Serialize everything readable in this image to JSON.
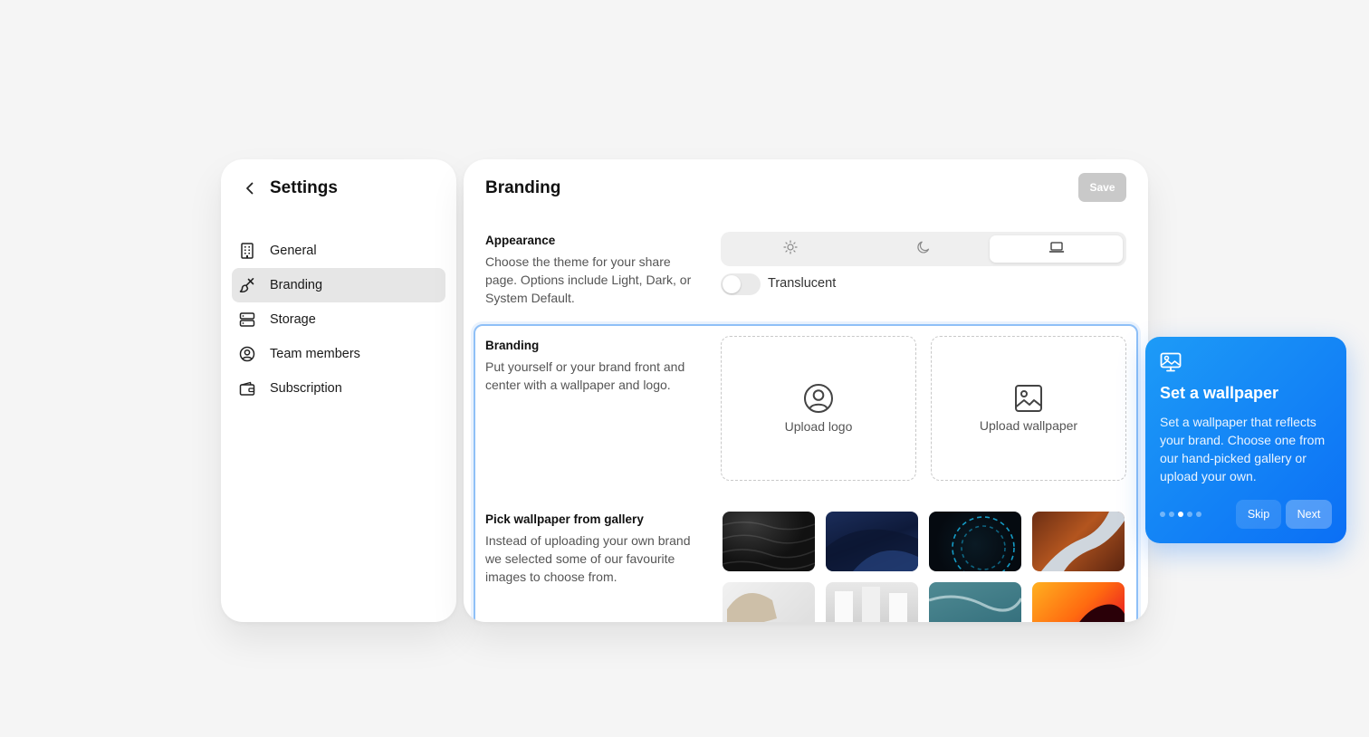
{
  "sidebar": {
    "title": "Settings",
    "items": [
      {
        "label": "General",
        "icon": "building-icon"
      },
      {
        "label": "Branding",
        "icon": "paintbrush-icon",
        "active": true
      },
      {
        "label": "Storage",
        "icon": "server-icon"
      },
      {
        "label": "Team members",
        "icon": "user-circle-icon"
      },
      {
        "label": "Subscription",
        "icon": "wallet-icon"
      }
    ]
  },
  "main": {
    "title": "Branding",
    "save_label": "Save",
    "appearance": {
      "label": "Appearance",
      "description": "Choose the theme for your share page. Options include Light, Dark, or System Default.",
      "themes": [
        "sun-icon",
        "moon-icon",
        "laptop-icon"
      ],
      "selected_theme": "laptop-icon",
      "translucent_label": "Translucent",
      "translucent_on": false
    },
    "branding": {
      "label": "Branding",
      "description": "Put yourself or your brand front and center with a wallpaper and logo.",
      "upload_logo": "Upload logo",
      "upload_wallpaper": "Upload wallpaper"
    },
    "gallery": {
      "label": "Pick wallpaper from gallery",
      "description": "Instead of uploading your own brand we selected some of our favourite images to choose from."
    }
  },
  "tour": {
    "title": "Set a wallpaper",
    "description": "Set a wallpaper that reflects your brand. Choose one from our hand-picked gallery or upload your own.",
    "skip_label": "Skip",
    "next_label": "Next",
    "step": 3,
    "total_steps": 5
  },
  "colors": {
    "accent": "#0b6ff5",
    "focus_outline": "#8fc0f7",
    "save_disabled": "#c9c9c9"
  }
}
